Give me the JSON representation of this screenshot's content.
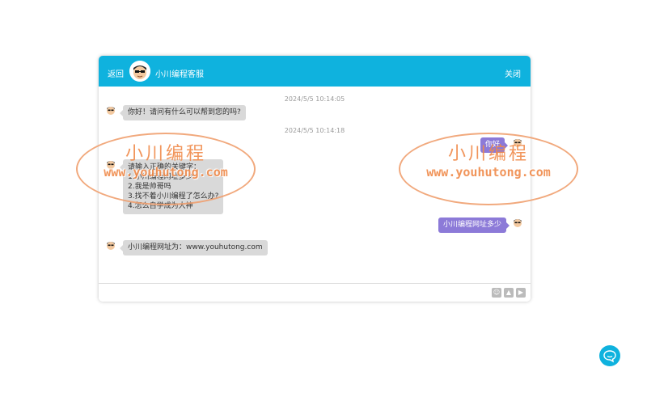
{
  "header": {
    "back_label": "返回",
    "title": "小川编程客服",
    "close_label": "关闭",
    "background": "#0fb2de"
  },
  "messages": [
    {
      "type": "timestamp",
      "text": "2024/5/5 10:14:05"
    },
    {
      "type": "received",
      "text": "你好！请问有什么可以帮到您的吗?"
    },
    {
      "type": "timestamp",
      "text": "2024/5/5 10:14:18"
    },
    {
      "type": "sent",
      "text": "你好"
    },
    {
      "type": "received",
      "lines": [
        "请输入正确的关键字：",
        "1.小川编程网址多少",
        "2.我是帅哥吗",
        "3.找不着小川编程了怎么办?",
        "4.怎么自学成为大神"
      ]
    },
    {
      "type": "sent",
      "text": "小川编程网址多少"
    },
    {
      "type": "received",
      "text": "小川编程网址为：www.youhutong.com"
    }
  ],
  "input": {
    "value": "",
    "placeholder": ""
  },
  "toolbar": {
    "icons": [
      "emoji-icon",
      "image-icon",
      "send-icon"
    ]
  },
  "watermark": {
    "cn": "小川编程",
    "url": "www.youhutong.com",
    "color": "#f08a4a"
  },
  "float_button": {
    "icon": "chat-icon"
  },
  "colors": {
    "sent_bubble": "#8c7ad8",
    "received_bubble": "#d9d9d9"
  }
}
